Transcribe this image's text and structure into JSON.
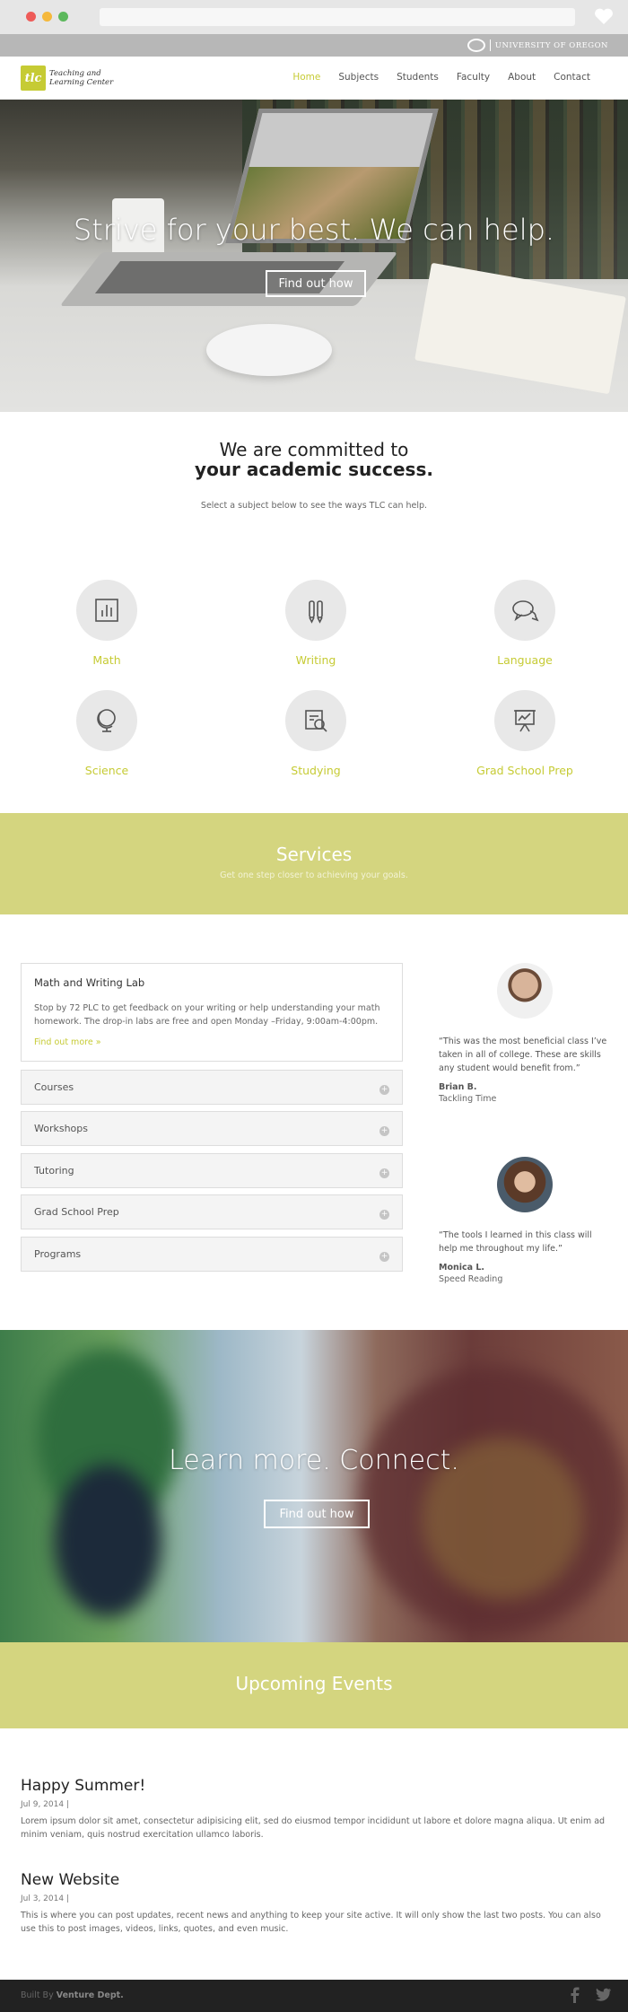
{
  "university": {
    "name": "UNIVERSITY OF OREGON"
  },
  "logo": {
    "mark": "tlc",
    "line1": "Teaching and",
    "line2": "Learning Center"
  },
  "nav": {
    "items": [
      "Home",
      "Subjects",
      "Students",
      "Faculty",
      "About",
      "Contact"
    ],
    "active": "Home"
  },
  "hero": {
    "title": "Strive for your best. We can help.",
    "button": "Find out how"
  },
  "commit": {
    "line1": "We are committed to",
    "line2": "your academic success.",
    "subtitle": "Select a subject below to see the ways TLC can help."
  },
  "subjects": [
    {
      "label": "Math",
      "icon": "bar-chart-icon"
    },
    {
      "label": "Writing",
      "icon": "pencil-pen-icon"
    },
    {
      "label": "Language",
      "icon": "speech-bubbles-icon"
    },
    {
      "label": "Science",
      "icon": "globe-icon"
    },
    {
      "label": "Studying",
      "icon": "magnify-document-icon"
    },
    {
      "label": "Grad School Prep",
      "icon": "presentation-board-icon"
    }
  ],
  "accent_color": "#c6cb34",
  "band_color": "#d4d57f",
  "services": {
    "title": "Services",
    "subtitle": "Get one step closer to achieving your goals."
  },
  "card": {
    "title": "Math and Writing Lab",
    "body": "Stop by 72 PLC to get feedback on your writing or help understanding your math homework. The drop-in labs are free and open Monday –Friday, 9:00am-4:00pm.",
    "link": "Find out more »"
  },
  "accordion": [
    "Courses",
    "Workshops",
    "Tutoring",
    "Grad School Prep",
    "Programs"
  ],
  "testimonials": [
    {
      "quote": "“This was the most beneficial class I’ve taken in all of college. These are skills any student would benefit from.”",
      "name": "Brian B.",
      "course": "Tackling Time"
    },
    {
      "quote": "“The tools I learned in this class will help me throughout my life.”",
      "name": "Monica L.",
      "course": "Speed Reading"
    }
  ],
  "hero2": {
    "title": "Learn more. Connect.",
    "button": "Find out how"
  },
  "events": {
    "title": "Upcoming Events"
  },
  "posts": [
    {
      "title": "Happy Summer!",
      "date": "Jul 9, 2014 |",
      "body": "Lorem ipsum dolor sit amet, consectetur adipisicing elit, sed do eiusmod tempor incididunt ut labore et dolore magna aliqua. Ut enim ad minim veniam, quis nostrud exercitation ullamco laboris."
    },
    {
      "title": "New Website",
      "date": "Jul 3, 2014 |",
      "body": "This is where you can post updates, recent news and anything to keep your site active. It will only show the last two posts. You can also use this to post images, videos, links, quotes, and even music."
    }
  ],
  "footer": {
    "prefix": "Built By",
    "author": "Venture Dept."
  }
}
